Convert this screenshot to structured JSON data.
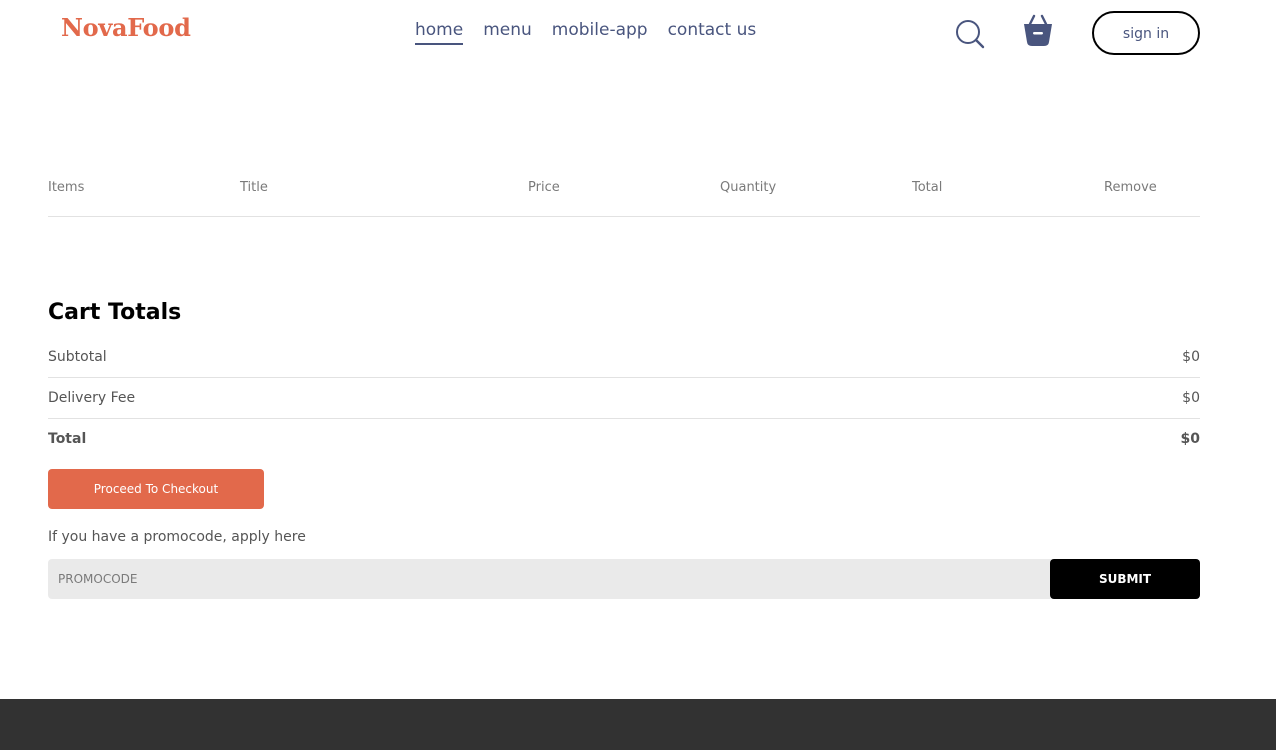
{
  "navbar": {
    "logo": "NovaFood",
    "menu": [
      {
        "label": "home",
        "active": true
      },
      {
        "label": "menu",
        "active": false
      },
      {
        "label": "mobile-app",
        "active": false
      },
      {
        "label": "contact us",
        "active": false
      }
    ],
    "search_icon": "search-icon",
    "basket_icon": "basket-icon",
    "signin_label": "sign in"
  },
  "cart": {
    "headers": [
      "Items",
      "Title",
      "Price",
      "Quantity",
      "Total",
      "Remove"
    ]
  },
  "totals": {
    "heading": "Cart Totals",
    "subtotal_label": "Subtotal",
    "subtotal_value": "$0",
    "delivery_label": "Delivery Fee",
    "delivery_value": "$0",
    "total_label": "Total",
    "total_value": "$0",
    "checkout_label": "Proceed To Checkout"
  },
  "promo": {
    "label": "If you have a promocode, apply here",
    "placeholder": "PROMOCODE",
    "value": "",
    "submit_label": "SUBMIT"
  },
  "colors": {
    "accent": "#e2694b",
    "nav_text": "#49557e",
    "footer_bg": "#323232",
    "promo_bg": "#eaeaea"
  }
}
